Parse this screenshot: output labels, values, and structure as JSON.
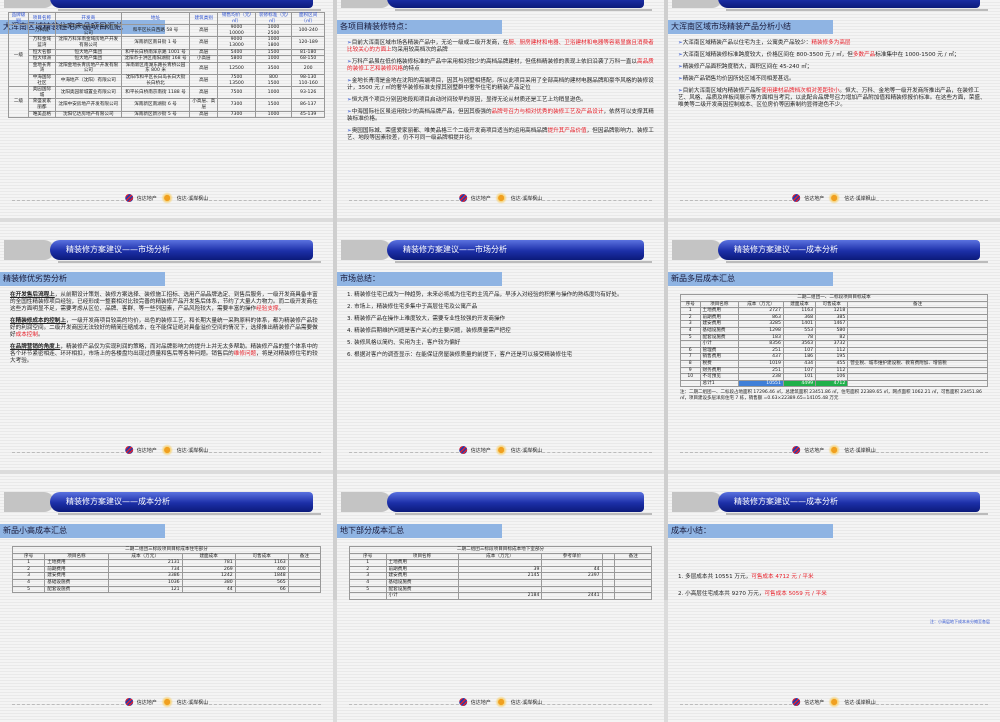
{
  "logo": {
    "brand": "信达地产",
    "project": "信达·溪岸枫山"
  },
  "colors": {
    "accent_red": "#e8202a",
    "header_blue": "#1c2fa8",
    "title_bar": "#8fb4e3",
    "total_cost": "#3f7fd8",
    "sale_cost": "#1fb04a"
  },
  "slides": [
    {
      "header": "",
      "title": "大浑南区域精装住宅产品项目汇总",
      "kind": "summary"
    },
    {
      "header": "",
      "title": "各项目精装修特点：",
      "kind": "paras",
      "arrow": true,
      "paras": [
        [
          {
            "t": "目前大浑南区域市场各精装产品中，无论一级或二级开发商，在"
          },
          {
            "t": "厨、厨房建材和电器、卫浴建材和电器等容易显露且消费者比较关心的方面上",
            "r": 1
          },
          {
            "t": "均采用较高档次的品牌"
          }
        ],
        [
          {
            "t": "万科产品虽在低价格装修标准的产品中采用相对较少的高档品牌建材，但低档精装修的表现上依旧沿袭了万科一直以"
          },
          {
            "t": "高品质的装修工艺和装修风格",
            "r": 1
          },
          {
            "t": "的特点"
          }
        ],
        [
          {
            "t": "金地长青湾是金地在沈阳的高端项目，因其与别墅相搭配，所以此项目采用了全部高档的建材电器品牌和豪华风格的装修设计，3500 元 / ㎡的奢华装修标准支撑其别墅群中奢华住宅的精装产品定位"
          }
        ],
        [
          {
            "t": "恒大两个项目分别因地段和项目启动时间较早的原因，显得无论从材质还是工艺上均稍显逊色。"
          }
        ],
        [
          {
            "t": "中海国际社区虽运用较少的高档品牌产品，但因其极强的"
          },
          {
            "t": "品牌号召力与相对优秀的装修工艺及产品设计",
            "r": 1
          },
          {
            "t": "，依然可以支撑其精装标准价格。"
          }
        ],
        [
          {
            "t": "奥园国际城、荣盛爱家丽都、唯美品格三个二级开发商项目适当的运用高档品牌"
          },
          {
            "t": "提升其产品价值",
            "r": 1
          },
          {
            "t": "，但因品牌影响力、装修工艺、地段等因素较差，仍不可同一级品牌相提并论。"
          }
        ]
      ]
    },
    {
      "header": "",
      "title": "大浑南区域市场精装产品分析小结",
      "kind": "paras",
      "arrow": true,
      "paras": [
        [
          {
            "t": "大浑南区域精装产品以住宅为主，公寓类产品较少："
          },
          {
            "t": "精装修多为高层",
            "r": 1
          }
        ],
        [
          {
            "t": "大浑南区域精装修标准跨度较大，价格区间在 800-3500 元 / ㎡，但"
          },
          {
            "t": "多数产品",
            "r": 1
          },
          {
            "t": "标准集中在 1000-1500 元 / ㎡；"
          }
        ],
        [
          {
            "t": "精装修产品面积跨度稍大，面积区间在 45-240 ㎡；"
          }
        ],
        [
          {
            "t": "精装产品销售均价因所处区域不同相差甚远。"
          }
        ],
        [
          {
            "t": "目前大浑南区域内精装修产品所"
          },
          {
            "t": "使用建材品牌档次相对差距较小",
            "r": 1
          },
          {
            "t": "。恒大、万科、金地等一级开发商所推出产品，在装修工艺、风格、品质及样板间展示等方面相当考究，以此配合品牌号召力增加产品附加值和精装修报价标准。在这些方面，荣盛、唯美等二级开发商因控制成本、区位房价等因素制约显得逊色不少。"
          }
        ]
      ]
    },
    {
      "header": "精装修方案建议——市场分析",
      "title": "精装修优劣势分析",
      "kind": "paras",
      "paras": [
        [
          {
            "t": "在开发售后流程上",
            "u": 1
          },
          {
            "t": "，从前期设计策划、装修方案选择、装修施工招标、选用产品品牌选定、到售后服务，一级开发商具备丰富的全国性精装修项目经验，已经形成一整套相对比较完善的精装修产品开发售后体系，节约了大量人力物力。而二级开发商在这些方面明显不足，需要考虑从区位、品牌、客群、等一些列因素，产品风险较大，需要丰富的操作"
          },
          {
            "t": "经验支撑",
            "r": 1
          },
          {
            "t": "。"
          }
        ],
        [
          {
            "t": "在精装修成本的控制上",
            "u": 1
          },
          {
            "t": "，一级开发商项目较高的均价，出色的装修工艺，和长期大量统一采购原料的体系，都为精装修产品较好的利润空间。二级开发商因无法较好的精简压缩成本，在不能保证绝对具备溢价空间的情况下，选择推出精装修产品需要做好"
          },
          {
            "t": "成本控制",
            "r": 1
          },
          {
            "t": "。"
          }
        ],
        [
          {
            "t": "在品牌营销的角度上",
            "u": 1
          },
          {
            "t": "，精装修产品仅为实现利润的策略，而对品牌影响力的提升上并无太多帮助。精装修产品的整个体系中的各个环节紧密相连、环环相扣，市场上的各楼盘均出现过质量和售后等各种问题。销售后的"
          },
          {
            "t": "维修问题",
            "r": 1
          },
          {
            "t": "，将是对精装修住宅的较大考验。"
          }
        ]
      ]
    },
    {
      "header": "精装修方案建议——市场分析",
      "title": "市场总结：",
      "kind": "paras",
      "paras": [
        [
          {
            "t": "1. 精装修住宅已成为一种趋势，未来必将成为住宅的主流产品，早涉入对经验的积累与操作的熟练度均有好处。"
          }
        ],
        [
          {
            "t": "2. 市场上，精装修住宅多集中于高层住宅及公寓产品"
          }
        ],
        [
          {
            "t": "3. 精装修产品在操作上难度较大，需要专业性较强的开发商操作"
          }
        ],
        [
          {
            "t": "4. 精装修后期维护问题是客户关心的主要问题，装修质量需严把控"
          }
        ],
        [
          {
            "t": "5. 装修风格以简约、实用为主，客户较为偏好"
          }
        ],
        [
          {
            "t": "6. 根据对客户的调查显示：在能保证房屋装修质量的前提下，客户还是可以接受精装修住宅"
          }
        ]
      ]
    },
    {
      "header": "精装修方案建议——成本分析",
      "title": "新品多层成本汇总",
      "kind": "cost",
      "table": {
        "caption": "二期二组团一、二标段项目目标成本",
        "columns": [
          "序号",
          "项目名称",
          "成本（万元）",
          "建面成本",
          "可售成本",
          "备注"
        ],
        "rows": [
          [
            "1",
            "土地费用",
            "2727",
            "1163",
            "1218",
            ""
          ],
          [
            "2",
            "前期费用",
            "863",
            "368",
            "385",
            ""
          ],
          [
            "3",
            "建安费用",
            "3285",
            "1401",
            "1467",
            ""
          ],
          [
            "4",
            "基础设施费",
            "1298",
            "553",
            "580",
            ""
          ],
          [
            "5",
            "配套设施费",
            "183",
            "78",
            "82",
            ""
          ],
          [
            "",
            "小计",
            "8356",
            "3563",
            "3732",
            ""
          ],
          [
            "6",
            "管理费",
            "251",
            "107",
            "112",
            ""
          ],
          [
            "7",
            "销售费用",
            "437",
            "186",
            "195",
            ""
          ],
          [
            "8",
            "税费",
            "1019",
            "434",
            "455",
            "营业税、城市维护建设税、教育费附加、增值税"
          ],
          [
            "9",
            "财务费用",
            "251",
            "107",
            "112",
            ""
          ],
          [
            "10",
            "不可预见",
            "238",
            "101",
            "106",
            ""
          ],
          [
            "",
            "总计1",
            "10551",
            "4499",
            "4712",
            ""
          ]
        ],
        "highlight_last": true,
        "note": "注：二期二组团一、二标段占地面积 17296.46 ㎡，总建筑面积 23451.86 ㎡，住宅面积 22389.65 ㎡，网点面积 1062.21 ㎡，可售面积 23451.86 ㎡，项目建设多层洋房住宅 7 栋，销售额 =0.63×22389.65=14105.48 万元"
      }
    },
    {
      "header": "精装修方案建议——成本分析",
      "title": "新品小高成本汇总",
      "kind": "cost",
      "table": {
        "caption": "二期二组团三标段项目目标成本住宅部分",
        "columns": [
          "序号",
          "项目名称",
          "成本（万元）",
          "建面成本",
          "可售成本",
          "备注"
        ],
        "rows": [
          [
            "1",
            "土地费用",
            "2131",
            "781",
            "1163",
            ""
          ],
          [
            "2",
            "前期费用",
            "734",
            "269",
            "400",
            ""
          ],
          [
            "3",
            "建安费用",
            "3386",
            "1242",
            "1848",
            ""
          ],
          [
            "4",
            "基础设施费",
            "1036",
            "380",
            "565",
            ""
          ],
          [
            "5",
            "配套设施费",
            "121",
            "44",
            "66",
            ""
          ]
        ]
      }
    },
    {
      "header": "",
      "title": "地下部分成本汇总",
      "kind": "cost",
      "table": {
        "caption": "二期二组团三标段项目目标成本地下室部分",
        "columns": [
          "序号",
          "项目名称",
          "成本（万元）",
          "参考单价",
          "",
          "备注"
        ],
        "rows": [
          [
            "1",
            "土地费用",
            "",
            "",
            "",
            ""
          ],
          [
            "2",
            "前期费用",
            "39",
            "44",
            "",
            ""
          ],
          [
            "3",
            "建安费用",
            "2145",
            "2397",
            "",
            ""
          ],
          [
            "4",
            "基础设施费",
            "",
            "",
            "",
            ""
          ],
          [
            "5",
            "配套设施费",
            "",
            "",
            "",
            ""
          ],
          [
            "",
            "小计",
            "2184",
            "2441",
            "",
            ""
          ]
        ]
      }
    },
    {
      "header": "精装修方案建议——成本分析",
      "title": "成本小结：",
      "kind": "paras",
      "spaced": true,
      "paras": [
        [
          {
            "t": "1. 多层成本共 10551 万元，"
          },
          {
            "t": "可售成本 4712 元 / 平米",
            "r": 1
          }
        ],
        [
          {
            "t": "2. 小高层住宅成本共 9270 万元，"
          },
          {
            "t": "可售成本 5059 元 / 平米",
            "r": 1
          }
        ]
      ],
      "note": "注：小高层地下成本未分摊至各层"
    }
  ],
  "summary_table": {
    "columns": [
      "品牌级别",
      "项目名称",
      "开发商",
      "地址",
      "建筑类别",
      "销售均价（元/㎡）",
      "装修标准（元/㎡）",
      "面积区间（㎡）"
    ],
    "groups": [
      {
        "level": "一级",
        "rows": [
          [
            "万科城",
            "沈阳万科永达房地产开发有限公司",
            "和平区长白西路 58 号",
            "高层",
            "9000 / 10000",
            "1000 / 2500",
            "100-240"
          ],
          [
            "万科金域蓝湾",
            "沈阳万科浑南金域房地产开发有限公司",
            "浑南新区南日街 1 号",
            "高层",
            "9000 / 13000",
            "1000 / 1800",
            "120-189"
          ],
          [
            "恒大名都",
            "恒大地产集团",
            "和平长白桥南浑京路 1001 号",
            "高层",
            "5400",
            "1500",
            "81-180"
          ],
          [
            "恒大绿洲",
            "恒大地产集团",
            "沈阳市于洪区南阳湖街 168 号",
            "小高层",
            "5800",
            "1000",
            "68-150"
          ],
          [
            "金地长青湾",
            "沈阳金地长青房地产开发有限公司",
            "浑南新区南湖东路长青桥公园东 800 米",
            "高层",
            "12500",
            "3500",
            "200"
          ],
          [
            "中海国际社区",
            "中海地产（沈阳）有限公司",
            "沈阳市和平区长白岛长白大街长白桥北",
            "高层",
            "7500 / 13500",
            "800 / 1500",
            "98-130 / 110-160"
          ]
        ]
      },
      {
        "level": "二级",
        "rows": [
          [
            "奥园国际城",
            "沈阳奥园新城置业有限公司",
            "和平长白桥南京南街 1188 号",
            "高层",
            "7500",
            "1000",
            "93-126"
          ],
          [
            "荣盛爱家丽都",
            "沈阳中安房地产开发有限公司",
            "浑南新区南湖街 6 号",
            "小高层、高层",
            "7300",
            "1500",
            "86-137"
          ],
          [
            "唯美品格",
            "沈阳亿达房地产有限公司",
            "浑南新区新沙街 5 号",
            "高层",
            "7300",
            "1000",
            "45-139"
          ]
        ]
      }
    ]
  }
}
